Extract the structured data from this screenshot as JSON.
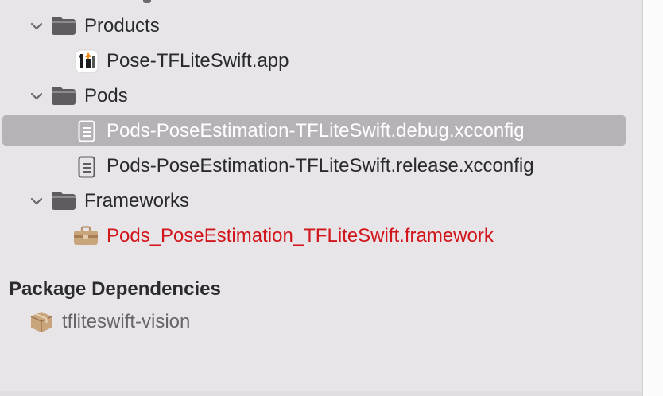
{
  "navigator": {
    "items": [
      {
        "label": "Products",
        "icon": "folder-icon",
        "expanded": true
      },
      {
        "label": "Pose-TFLiteSwift.app",
        "icon": "app-icon"
      },
      {
        "label": "Pods",
        "icon": "folder-icon",
        "expanded": true
      },
      {
        "label": "Pods-PoseEstimation-TFLiteSwift.debug.xcconfig",
        "icon": "document-icon",
        "selected": true
      },
      {
        "label": "Pods-PoseEstimation-TFLiteSwift.release.xcconfig",
        "icon": "document-icon"
      },
      {
        "label": "Frameworks",
        "icon": "folder-icon",
        "expanded": true
      },
      {
        "label": "Pods_PoseEstimation_TFLiteSwift.framework",
        "icon": "toolbox-icon",
        "status": "missing"
      }
    ],
    "package_section": {
      "title": "Package Dependencies",
      "items": [
        {
          "label": "tfliteswift-vision",
          "icon": "package-icon"
        }
      ]
    }
  },
  "colors": {
    "selection": "#b7b2b8",
    "missing_text": "#d1161b",
    "folder": "#5e5c61",
    "package": "#b9916a"
  }
}
